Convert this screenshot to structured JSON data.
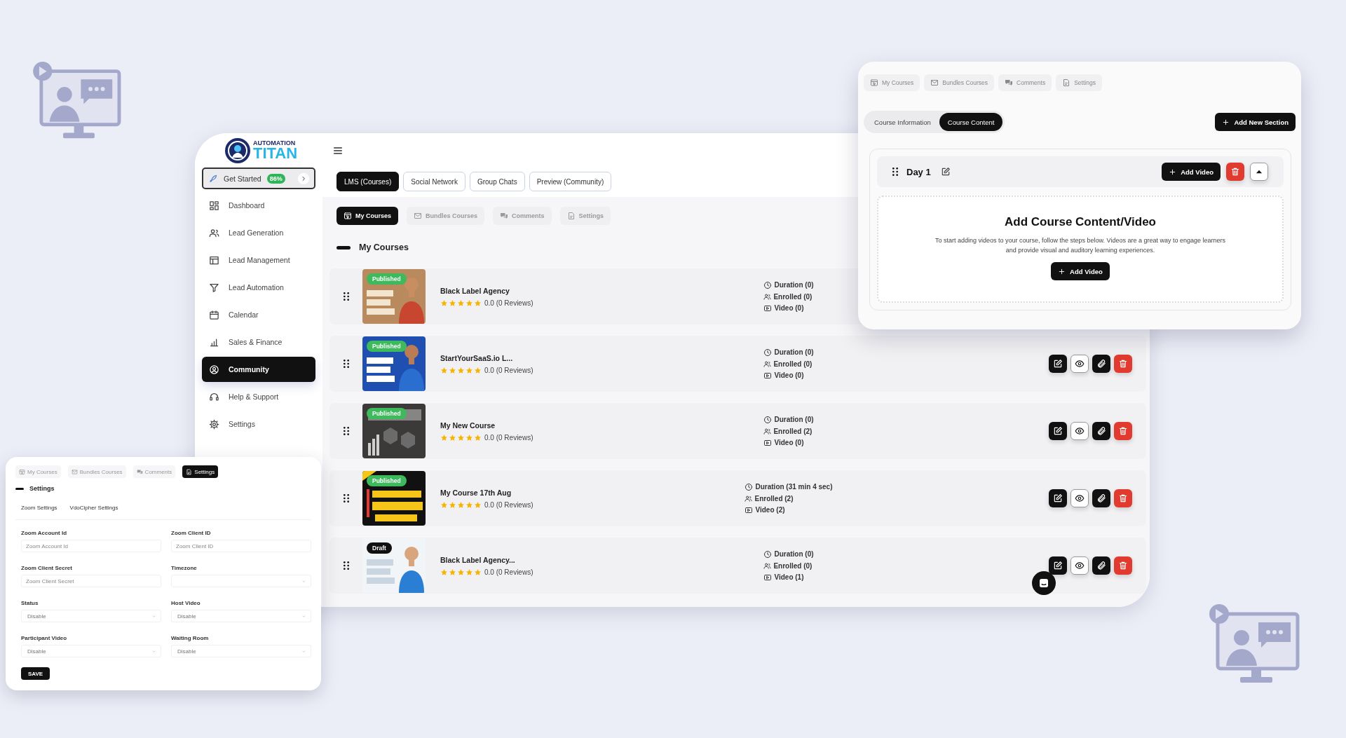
{
  "main_window": {
    "logo": {
      "line1": "AUTOMATION",
      "line2": "TITAN"
    },
    "get_started": {
      "label": "Get Started",
      "badge": "86%"
    },
    "sidebar": {
      "items": [
        {
          "label": "Dashboard",
          "selected": false
        },
        {
          "label": "Lead Generation",
          "selected": false
        },
        {
          "label": "Lead Management",
          "selected": false
        },
        {
          "label": "Lead Automation",
          "selected": false
        },
        {
          "label": "Calendar",
          "selected": false
        },
        {
          "label": "Sales & Finance",
          "selected": false
        },
        {
          "label": "Community",
          "selected": true
        },
        {
          "label": "Help & Support",
          "selected": false
        },
        {
          "label": "Settings",
          "selected": false
        }
      ]
    },
    "top_tabs": [
      {
        "label": "LMS (Courses)",
        "selected": true
      },
      {
        "label": "Social Network",
        "selected": false
      },
      {
        "label": "Group Chats",
        "selected": false
      },
      {
        "label": "Preview (Community)",
        "selected": false
      }
    ],
    "sub_tabs": [
      {
        "label": "My Courses",
        "selected": true
      },
      {
        "label": "Bundles Courses",
        "selected": false
      },
      {
        "label": "Comments",
        "selected": false
      },
      {
        "label": "Settings",
        "selected": false
      }
    ],
    "section_title": "My Courses",
    "courses": [
      {
        "status": "Published",
        "kind": "published",
        "title": "Black Label Agency",
        "stars": 5,
        "rating": "0.0 (0 Reviews)",
        "duration": "Duration (0)",
        "enrolled": "Enrolled (0)",
        "videos": "Video (0)"
      },
      {
        "status": "Published",
        "kind": "published",
        "title": "StartYourSaaS.io L...",
        "stars": 5,
        "rating": "0.0 (0 Reviews)",
        "duration": "Duration (0)",
        "enrolled": "Enrolled (0)",
        "videos": "Video (0)",
        "actions": [
          {
            "kind": "edit"
          },
          {
            "kind": "view"
          },
          {
            "kind": "attach"
          },
          {
            "kind": "delete"
          }
        ]
      },
      {
        "status": "Published",
        "kind": "published",
        "title": "My New Course",
        "stars": 5,
        "rating": "0.0 (0 Reviews)",
        "duration": "Duration (0)",
        "enrolled": "Enrolled (2)",
        "videos": "Video (0)",
        "actions": [
          {
            "kind": "edit"
          },
          {
            "kind": "view"
          },
          {
            "kind": "attach"
          },
          {
            "kind": "delete"
          }
        ]
      },
      {
        "status": "Published",
        "kind": "published",
        "title": "My Course 17th Aug",
        "stars": 5,
        "rating": "0.0 (0 Reviews)",
        "duration": "Duration (31 min 4 sec)",
        "enrolled": "Enrolled (2)",
        "videos": "Video (2)",
        "actions": [
          {
            "kind": "edit"
          },
          {
            "kind": "view"
          },
          {
            "kind": "attach"
          },
          {
            "kind": "delete"
          }
        ]
      },
      {
        "status": "Draft",
        "kind": "draft",
        "title": "Black Label Agency...",
        "stars": 5,
        "rating": "0.0 (0 Reviews)",
        "duration": "Duration (0)",
        "enrolled": "Enrolled (0)",
        "videos": "Video (1)",
        "actions": [
          {
            "kind": "edit"
          },
          {
            "kind": "view"
          },
          {
            "kind": "attach"
          },
          {
            "kind": "delete"
          }
        ]
      }
    ]
  },
  "course_editor": {
    "tabs": [
      {
        "label": "My Courses",
        "selected": false
      },
      {
        "label": "Bundles Courses",
        "selected": false
      },
      {
        "label": "Comments",
        "selected": false
      },
      {
        "label": "Settings",
        "selected": false
      }
    ],
    "segments": [
      {
        "label": "Course Information",
        "selected": false
      },
      {
        "label": "Course Content",
        "selected": true
      }
    ],
    "add_section_button": "Add New Section",
    "section": {
      "title": "Day 1",
      "add_video_button": "Add Video",
      "expanded": true
    },
    "empty_state": {
      "heading": "Add Course Content/Video",
      "text": "To start adding videos to your course, follow the steps below. Videos are a great way to engage learners and provide visual and auditory learning experiences.",
      "button": "Add Video"
    }
  },
  "settings_panel": {
    "tabs": [
      {
        "label": "My Courses",
        "selected": false
      },
      {
        "label": "Bundles Courses",
        "selected": false
      },
      {
        "label": "Comments",
        "selected": false
      },
      {
        "label": "Settings",
        "selected": true
      }
    ],
    "title": "Settings",
    "sub_tabs": [
      "Zoom Settings",
      "VdoCipher Settings"
    ],
    "fields": [
      {
        "label": "Zoom Account Id",
        "kind": "input",
        "placeholder": "Zoom Account Id"
      },
      {
        "label": "Zoom Client ID",
        "kind": "input",
        "placeholder": "Zoom Client ID"
      },
      {
        "label": "Zoom Client Secret",
        "kind": "input",
        "placeholder": "Zoom Client Secret"
      },
      {
        "label": "Timezone",
        "kind": "select"
      },
      {
        "label": "Status",
        "kind": "select",
        "value": "Disable"
      },
      {
        "label": "Host Video",
        "kind": "select",
        "value": "Disable"
      },
      {
        "label": "Participant Video",
        "kind": "select",
        "value": "Disable"
      },
      {
        "label": "Waiting Room",
        "kind": "select",
        "value": "Disable"
      }
    ],
    "save_button": "SAVE"
  }
}
